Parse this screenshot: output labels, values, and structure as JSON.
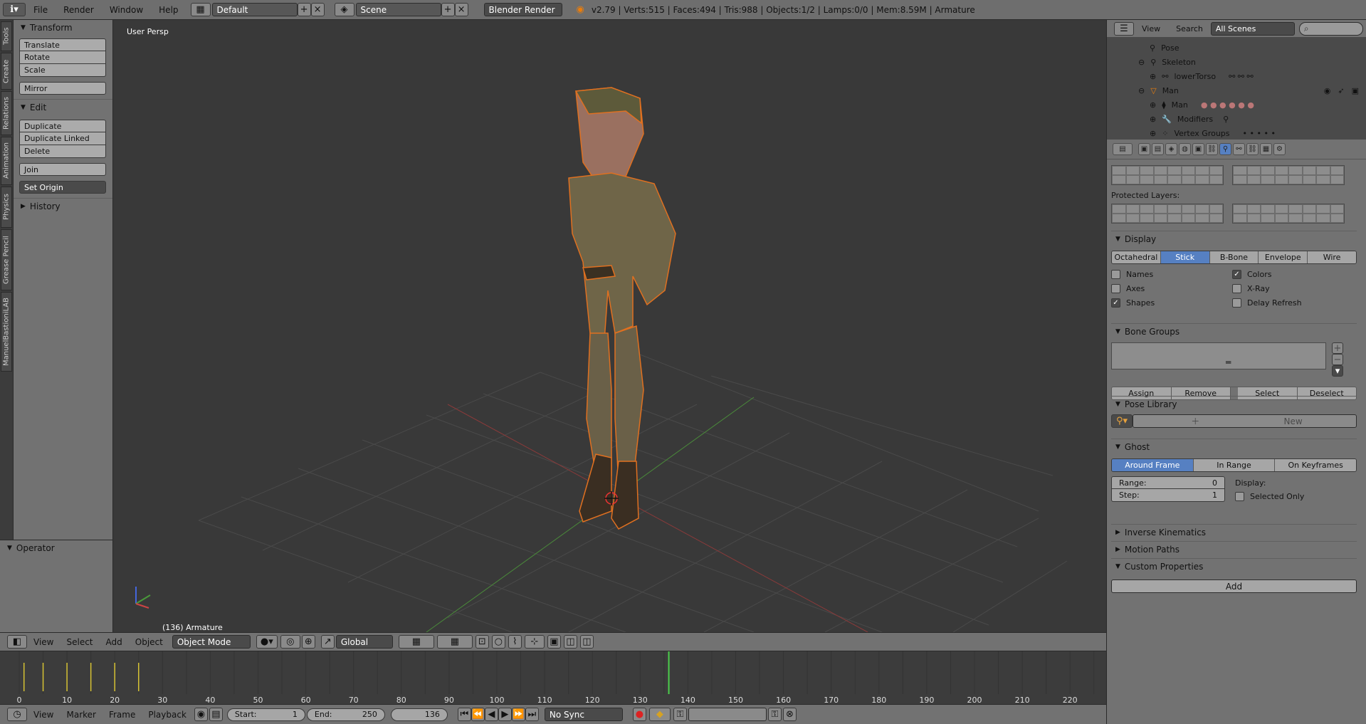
{
  "topbar": {
    "menus": [
      "File",
      "Render",
      "Window",
      "Help"
    ],
    "layout": "Default",
    "scene": "Scene",
    "engine": "Blender Render",
    "stats": "v2.79 | Verts:515 | Faces:494 | Tris:988 | Objects:1/2 | Lamps:0/0 | Mem:8.59M | Armature"
  },
  "toolstabs": [
    "Tools",
    "Create",
    "Relations",
    "Animation",
    "Physics",
    "Grease Pencil",
    "ManuelBastioniLAB"
  ],
  "toolshelf": {
    "transform_title": "Transform",
    "translate": "Translate",
    "rotate": "Rotate",
    "scale": "Scale",
    "mirror": "Mirror",
    "edit_title": "Edit",
    "duplicate": "Duplicate",
    "duplicate_linked": "Duplicate Linked",
    "delete": "Delete",
    "join": "Join",
    "set_origin": "Set Origin",
    "history_title": "History",
    "operator_title": "Operator"
  },
  "viewport": {
    "label": "User Persp",
    "object_label": "(136) Armature"
  },
  "vbar": {
    "menus": [
      "View",
      "Select",
      "Add",
      "Object"
    ],
    "mode": "Object Mode",
    "orientation": "Global"
  },
  "timeline": {
    "ticks": [
      "0",
      "10",
      "20",
      "30",
      "40",
      "50",
      "60",
      "70",
      "80",
      "90",
      "100",
      "110",
      "120",
      "130",
      "140",
      "150",
      "160",
      "170",
      "180",
      "190",
      "200",
      "210",
      "220"
    ],
    "current_frame_value": 136
  },
  "tbar": {
    "menus": [
      "View",
      "Marker",
      "Frame",
      "Playback"
    ],
    "start_label": "Start:",
    "start": "1",
    "end_label": "End:",
    "end": "250",
    "current": "136",
    "sync": "No Sync"
  },
  "outliner": {
    "view": "View",
    "search": "Search",
    "scenes": "All Scenes",
    "rows": [
      "Pose",
      "Skeleton",
      "lowerTorso",
      "Man",
      "Man",
      "Modifiers",
      "Vertex Groups"
    ]
  },
  "props": {
    "protected_layers": "Protected Layers:",
    "display_title": "Display",
    "display_modes": [
      "Octahedral",
      "Stick",
      "B-Bone",
      "Envelope",
      "Wire"
    ],
    "names": "Names",
    "axes": "Axes",
    "shapes": "Shapes",
    "colors": "Colors",
    "xray": "X-Ray",
    "delay_refresh": "Delay Refresh",
    "bone_groups_title": "Bone Groups",
    "assign": "Assign",
    "remove": "Remove",
    "select": "Select",
    "deselect": "Deselect",
    "pose_library_title": "Pose Library",
    "new": "New",
    "ghost_title": "Ghost",
    "ghost_modes": [
      "Around Frame",
      "In Range",
      "On Keyframes"
    ],
    "range_label": "Range:",
    "range": "0",
    "step_label": "Step:",
    "step": "1",
    "display_label": "Display:",
    "selected_only": "Selected Only",
    "ik_title": "Inverse Kinematics",
    "motion_paths_title": "Motion Paths",
    "custom_props_title": "Custom Properties",
    "add": "Add"
  }
}
